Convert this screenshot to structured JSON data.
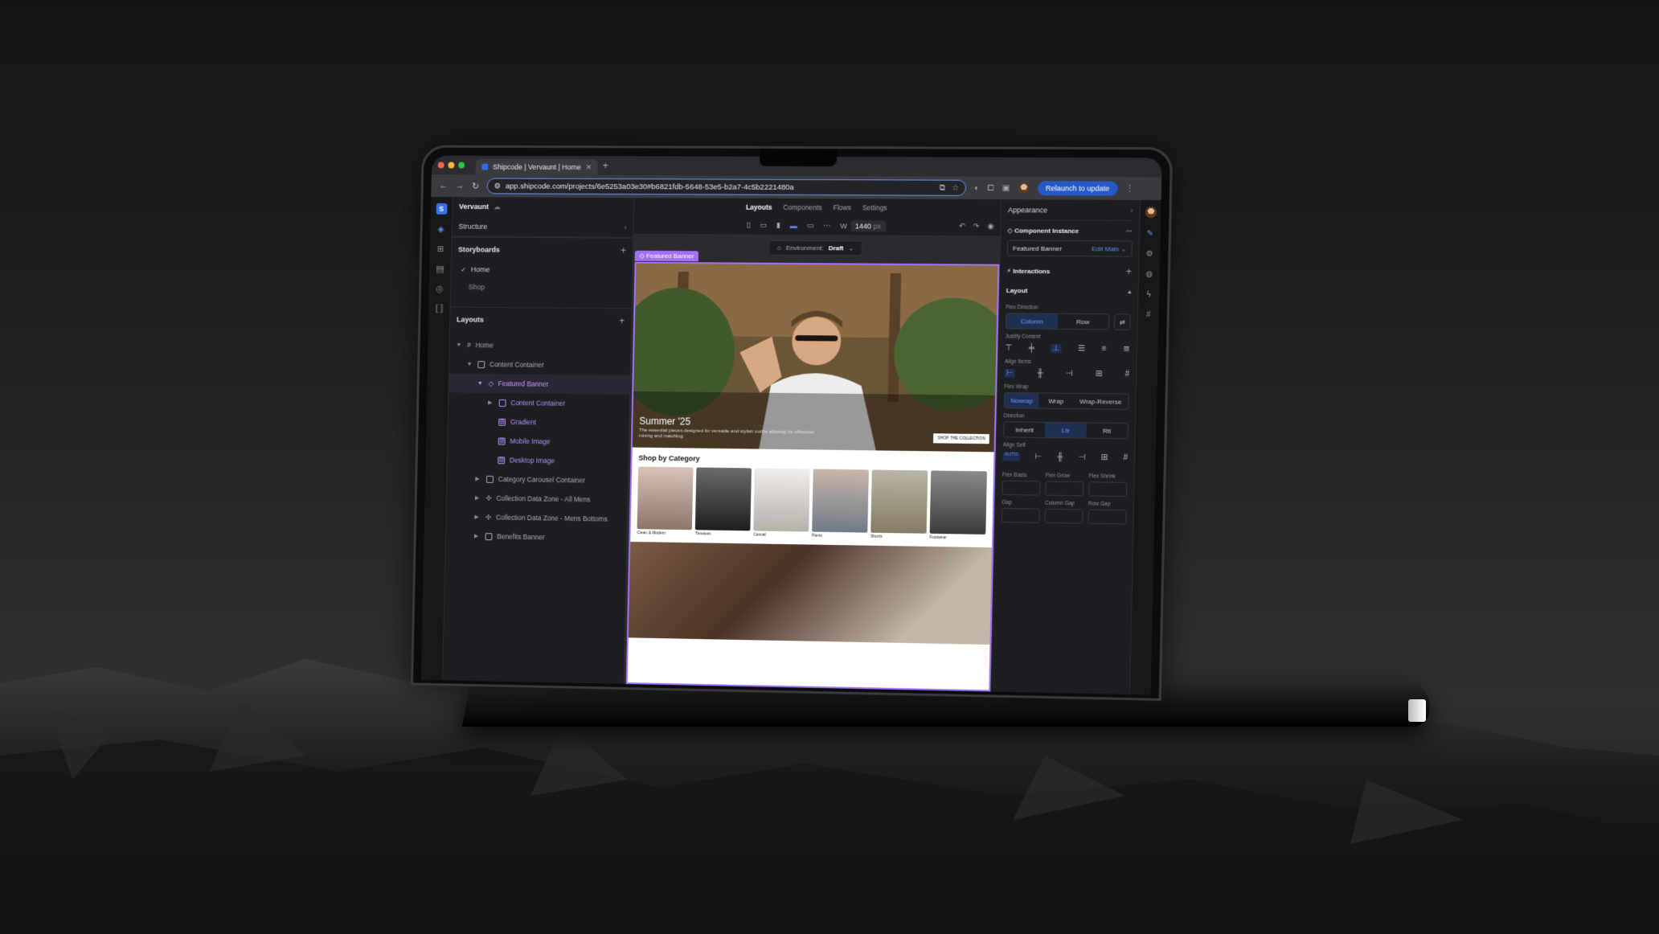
{
  "browser": {
    "tab_title": "Shipcode | Vervaunt | Home",
    "url": "app.shipcode.com/projects/6e5253a03e30#b6821fdb-5648-53e5-b2a7-4c5b2221480a",
    "relaunch_label": "Relaunch to update"
  },
  "project": {
    "name": "Vervaunt"
  },
  "top_nav": [
    "Layouts",
    "Components",
    "Flows",
    "Settings"
  ],
  "toolbar": {
    "width_label": "W",
    "width_value": "1440",
    "width_unit": "px"
  },
  "environment": {
    "label": "Environment:",
    "value": "Draft"
  },
  "structure": {
    "title": "Structure",
    "storyboards_label": "Storyboards",
    "storyboards": [
      "Home",
      "Shop"
    ],
    "layouts_label": "Layouts",
    "tree": [
      {
        "label": "Home"
      },
      {
        "label": "Content Container"
      },
      {
        "label": "Featured Banner"
      },
      {
        "label": "Content Container"
      },
      {
        "label": "Gradient"
      },
      {
        "label": "Mobile Image"
      },
      {
        "label": "Desktop Image"
      },
      {
        "label": "Category Carousel Container"
      },
      {
        "label": "Collection Data Zone - All Mens"
      },
      {
        "label": "Collection Data Zone - Mens Bottoms"
      },
      {
        "label": "Benefits Banner"
      }
    ]
  },
  "canvas": {
    "frame_tag": "Featured Banner",
    "hero_title": "Summer '25",
    "hero_sub": "The essential pieces designed for versatile and stylish outfits allowing for effortless mixing and matching.",
    "hero_button": "SHOP THE COLLECTION",
    "category_title": "Shop by Category",
    "categories": [
      "Clean & Modern",
      "Timeless",
      "Casual",
      "Pants",
      "Shorts",
      "Footwear"
    ]
  },
  "appearance": {
    "title": "Appearance",
    "component_instance_label": "Component Instance",
    "instance_name": "Featured Banner",
    "edit_main_label": "Edit Main",
    "interactions_label": "Interactions",
    "layout_label": "Layout",
    "flex_direction_label": "Flex Direction",
    "flex_direction_options": [
      "Column",
      "Row"
    ],
    "justify_content_label": "Justify Content",
    "align_items_label": "Align Items",
    "flex_wrap_label": "Flex Wrap",
    "flex_wrap_options": [
      "Nowrap",
      "Wrap",
      "Wrap-Reverse"
    ],
    "direction_label": "Direction",
    "direction_options": [
      "Inherit",
      "Ltr",
      "Rtl"
    ],
    "align_self_label": "Align Self",
    "align_self_auto": "AUTO",
    "flex_basis_label": "Flex Basis",
    "flex_grow_label": "Flex Grow",
    "flex_shrink_label": "Flex Shrink",
    "gap_label": "Gap",
    "column_gap_label": "Column Gap",
    "row_gap_label": "Row Gap"
  },
  "colors": {
    "accent": "#a371f7",
    "primary": "#2459c7",
    "selected": "#5b8cf0"
  }
}
